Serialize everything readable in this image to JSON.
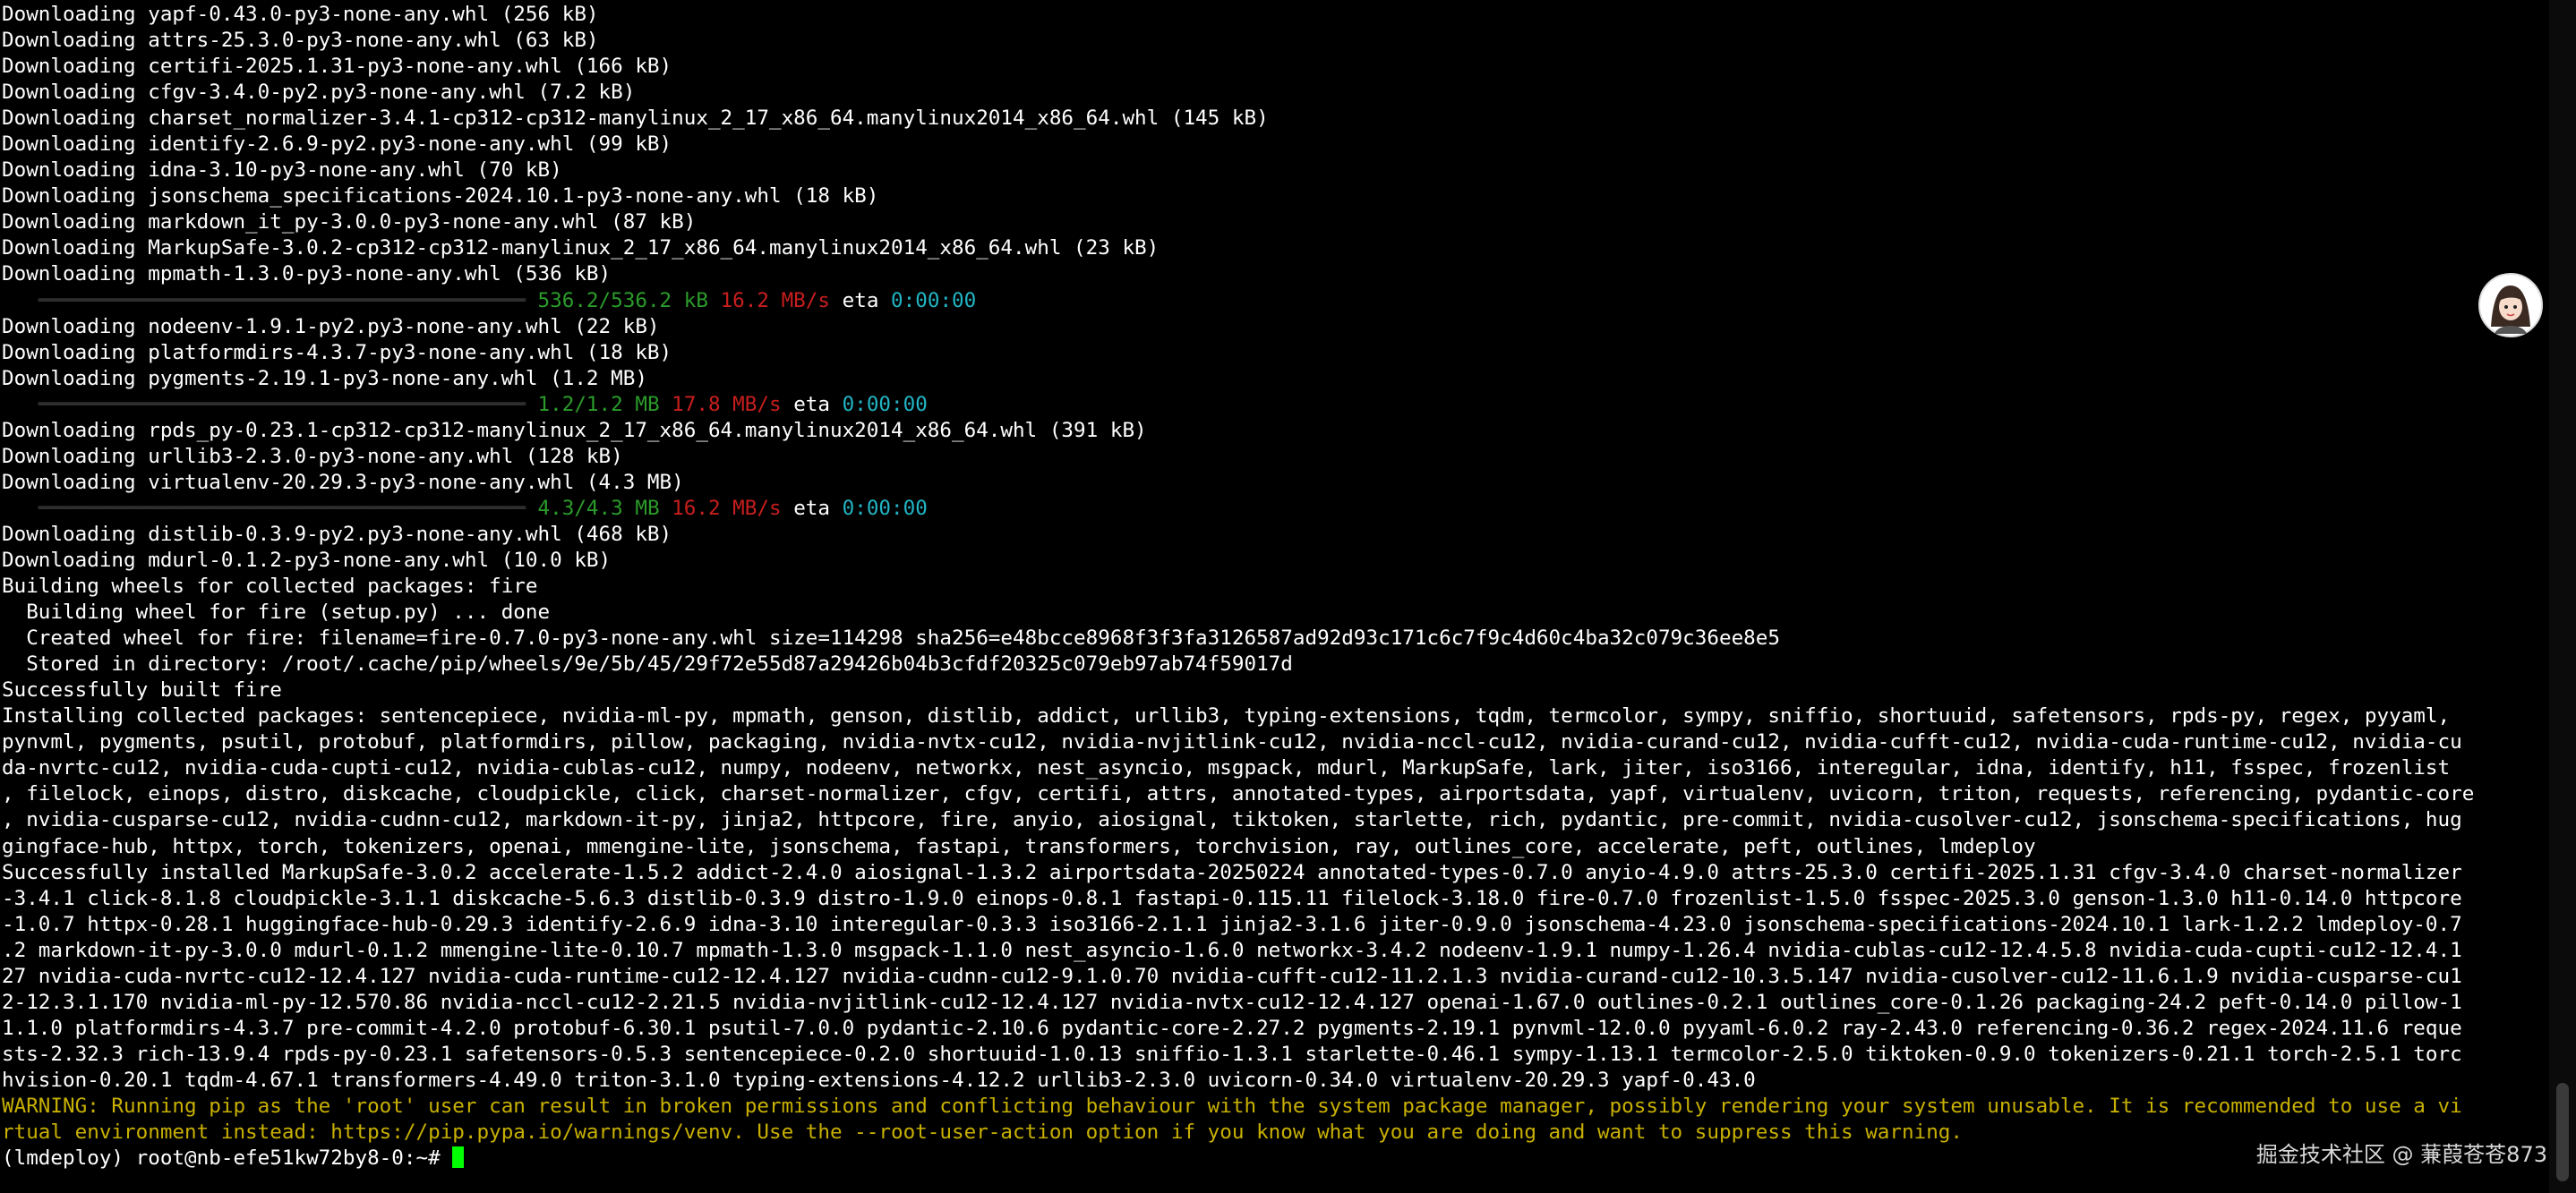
{
  "terminal": {
    "lines": [
      "Downloading yapf-0.43.0-py3-none-any.whl (256 kB)",
      "Downloading attrs-25.3.0-py3-none-any.whl (63 kB)",
      "Downloading certifi-2025.1.31-py3-none-any.whl (166 kB)",
      "Downloading cfgv-3.4.0-py2.py3-none-any.whl (7.2 kB)",
      "Downloading charset_normalizer-3.4.1-cp312-cp312-manylinux_2_17_x86_64.manylinux2014_x86_64.whl (145 kB)",
      "Downloading identify-2.6.9-py2.py3-none-any.whl (99 kB)",
      "Downloading idna-3.10-py3-none-any.whl (70 kB)",
      "Downloading jsonschema_specifications-2024.10.1-py3-none-any.whl (18 kB)",
      "Downloading markdown_it_py-3.0.0-py3-none-any.whl (87 kB)",
      "Downloading MarkupSafe-3.0.2-cp312-cp312-manylinux_2_17_x86_64.manylinux2014_x86_64.whl (23 kB)",
      "Downloading mpmath-1.3.0-py3-none-any.whl (536 kB)",
      {
        "progress": {
          "bar": "   ━━━━━━━━━━━━━━━━━━━━━━━━━━━━━━━━━━━━━━━━ ",
          "amount": "536.2/536.2 kB",
          "rate": "16.2 MB/s",
          "eta_label": "eta",
          "eta": "0:00:00"
        }
      },
      "Downloading nodeenv-1.9.1-py2.py3-none-any.whl (22 kB)",
      "Downloading platformdirs-4.3.7-py3-none-any.whl (18 kB)",
      "Downloading pygments-2.19.1-py3-none-any.whl (1.2 MB)",
      {
        "progress": {
          "bar": "   ━━━━━━━━━━━━━━━━━━━━━━━━━━━━━━━━━━━━━━━━ ",
          "amount": "1.2/1.2 MB",
          "rate": "17.8 MB/s",
          "eta_label": "eta",
          "eta": "0:00:00"
        }
      },
      "Downloading rpds_py-0.23.1-cp312-cp312-manylinux_2_17_x86_64.manylinux2014_x86_64.whl (391 kB)",
      "Downloading urllib3-2.3.0-py3-none-any.whl (128 kB)",
      "Downloading virtualenv-20.29.3-py3-none-any.whl (4.3 MB)",
      {
        "progress": {
          "bar": "   ━━━━━━━━━━━━━━━━━━━━━━━━━━━━━━━━━━━━━━━━ ",
          "amount": "4.3/4.3 MB",
          "rate": "16.2 MB/s",
          "eta_label": "eta",
          "eta": "0:00:00"
        }
      },
      "Downloading distlib-0.3.9-py2.py3-none-any.whl (468 kB)",
      "Downloading mdurl-0.1.2-py3-none-any.whl (10.0 kB)",
      "Building wheels for collected packages: fire",
      "  Building wheel for fire (setup.py) ... done",
      "  Created wheel for fire: filename=fire-0.7.0-py3-none-any.whl size=114298 sha256=e48bcce8968f3f3fa3126587ad92d93c171c6c7f9c4d60c4ba32c079c36ee8e5",
      "  Stored in directory: /root/.cache/pip/wheels/9e/5b/45/29f72e55d87a29426b04b3cfdf20325c079eb97ab74f59017d",
      "Successfully built fire",
      "Installing collected packages: sentencepiece, nvidia-ml-py, mpmath, genson, distlib, addict, urllib3, typing-extensions, tqdm, termcolor, sympy, sniffio, shortuuid, safetensors, rpds-py, regex, pyyaml,",
      "pynvml, pygments, psutil, protobuf, platformdirs, pillow, packaging, nvidia-nvtx-cu12, nvidia-nvjitlink-cu12, nvidia-nccl-cu12, nvidia-curand-cu12, nvidia-cufft-cu12, nvidia-cuda-runtime-cu12, nvidia-cu",
      "da-nvrtc-cu12, nvidia-cuda-cupti-cu12, nvidia-cublas-cu12, numpy, nodeenv, networkx, nest_asyncio, msgpack, mdurl, MarkupSafe, lark, jiter, iso3166, interegular, idna, identify, h11, fsspec, frozenlist",
      ", filelock, einops, distro, diskcache, cloudpickle, click, charset-normalizer, cfgv, certifi, attrs, annotated-types, airportsdata, yapf, virtualenv, uvicorn, triton, requests, referencing, pydantic-core",
      ", nvidia-cusparse-cu12, nvidia-cudnn-cu12, markdown-it-py, jinja2, httpcore, fire, anyio, aiosignal, tiktoken, starlette, rich, pydantic, pre-commit, nvidia-cusolver-cu12, jsonschema-specifications, hug",
      "gingface-hub, httpx, torch, tokenizers, openai, mmengine-lite, jsonschema, fastapi, transformers, torchvision, ray, outlines_core, accelerate, peft, outlines, lmdeploy",
      "Successfully installed MarkupSafe-3.0.2 accelerate-1.5.2 addict-2.4.0 aiosignal-1.3.2 airportsdata-20250224 annotated-types-0.7.0 anyio-4.9.0 attrs-25.3.0 certifi-2025.1.31 cfgv-3.4.0 charset-normalizer",
      "-3.4.1 click-8.1.8 cloudpickle-3.1.1 diskcache-5.6.3 distlib-0.3.9 distro-1.9.0 einops-0.8.1 fastapi-0.115.11 filelock-3.18.0 fire-0.7.0 frozenlist-1.5.0 fsspec-2025.3.0 genson-1.3.0 h11-0.14.0 httpcore",
      "-1.0.7 httpx-0.28.1 huggingface-hub-0.29.3 identify-2.6.9 idna-3.10 interegular-0.3.3 iso3166-2.1.1 jinja2-3.1.6 jiter-0.9.0 jsonschema-4.23.0 jsonschema-specifications-2024.10.1 lark-1.2.2 lmdeploy-0.7",
      ".2 markdown-it-py-3.0.0 mdurl-0.1.2 mmengine-lite-0.10.7 mpmath-1.3.0 msgpack-1.1.0 nest_asyncio-1.6.0 networkx-3.4.2 nodeenv-1.9.1 numpy-1.26.4 nvidia-cublas-cu12-12.4.5.8 nvidia-cuda-cupti-cu12-12.4.1",
      "27 nvidia-cuda-nvrtc-cu12-12.4.127 nvidia-cuda-runtime-cu12-12.4.127 nvidia-cudnn-cu12-9.1.0.70 nvidia-cufft-cu12-11.2.1.3 nvidia-curand-cu12-10.3.5.147 nvidia-cusolver-cu12-11.6.1.9 nvidia-cusparse-cu1",
      "2-12.3.1.170 nvidia-ml-py-12.570.86 nvidia-nccl-cu12-2.21.5 nvidia-nvjitlink-cu12-12.4.127 nvidia-nvtx-cu12-12.4.127 openai-1.67.0 outlines-0.2.1 outlines_core-0.1.26 packaging-24.2 peft-0.14.0 pillow-1",
      "1.1.0 platformdirs-4.3.7 pre-commit-4.2.0 protobuf-6.30.1 psutil-7.0.0 pydantic-2.10.6 pydantic-core-2.27.2 pygments-2.19.1 pynvml-12.0.0 pyyaml-6.0.2 ray-2.43.0 referencing-0.36.2 regex-2024.11.6 reque",
      "sts-2.32.3 rich-13.9.4 rpds-py-0.23.1 safetensors-0.5.3 sentencepiece-0.2.0 shortuuid-1.0.13 sniffio-1.3.1 starlette-0.46.1 sympy-1.13.1 termcolor-2.5.0 tiktoken-0.9.0 tokenizers-0.21.1 torch-2.5.1 torc",
      "hvision-0.20.1 tqdm-4.67.1 transformers-4.49.0 triton-3.1.0 typing-extensions-4.12.2 urllib3-2.3.0 uvicorn-0.34.0 virtualenv-20.29.3 yapf-0.43.0",
      {
        "warn": "WARNING: Running pip as the 'root' user can result in broken permissions and conflicting behaviour with the system package manager, possibly rendering your system unusable. It is recommended to use a vi"
      },
      {
        "warn": "rtual environment instead: https://pip.pypa.io/warnings/venv. Use the --root-user-action option if you know what you are doing and want to suppress this warning."
      },
      {
        "prompt": "(lmdeploy) root@nb-efe51kw72by8-0:~# "
      }
    ],
    "colors": {
      "background": "#000000",
      "text": "#ffffff",
      "progress_amount": "#2b9c2b",
      "progress_rate": "#c81e1e",
      "progress_eta": "#22b5c4",
      "warning": "#c8b000",
      "cursor": "#00ff00"
    }
  },
  "avatar": {
    "icon": "avatar-icon"
  },
  "watermark": "掘金技术社区 @ 蒹葭苍苍873"
}
